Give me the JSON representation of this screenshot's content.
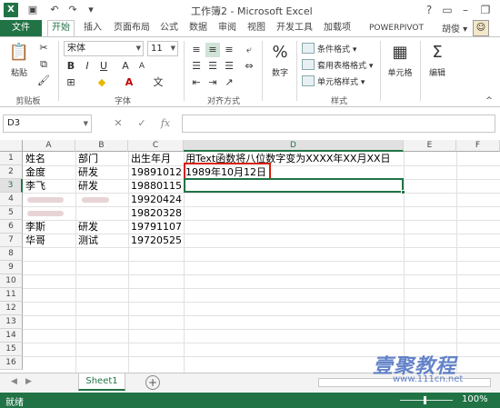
{
  "app": {
    "title": "工作簿2 - Microsoft Excel",
    "badge": "X"
  },
  "ribbon_tabs": {
    "file": "文件",
    "tabs": [
      "开始",
      "插入",
      "页面布局",
      "公式",
      "数据",
      "审阅",
      "视图",
      "开发工具",
      "加载项",
      "POWERPIVOT"
    ],
    "user": "胡俊 ▾"
  },
  "ribbon": {
    "paste": "粘贴",
    "font_name": "宋体",
    "font_size": "11",
    "number_label": "数字",
    "cond_format": "条件格式 ▾",
    "table_format": "套用表格格式 ▾",
    "cell_style": "单元格样式 ▾",
    "cells_label": "单元格",
    "edit_label": "编辑",
    "groups": {
      "clipboard": "剪贴板",
      "font": "字体",
      "align": "对齐方式",
      "styles": "样式"
    }
  },
  "formula_bar": {
    "name_box": "D3",
    "formula": ""
  },
  "sheet": {
    "columns": [
      "A",
      "B",
      "C",
      "D",
      "E",
      "F"
    ],
    "rows": [
      "1",
      "2",
      "3",
      "4",
      "5",
      "6",
      "7",
      "8",
      "9",
      "10",
      "11",
      "12",
      "13",
      "14",
      "15",
      "16"
    ],
    "cells": {
      "A1": "姓名",
      "B1": "部门",
      "C1": "出生年月",
      "D1": "用Text函数将八位数字变为XXXX年XX月XX日",
      "A2": "金度",
      "B2": "研发",
      "C2": "19891012",
      "D2": "1989年10月12日",
      "A3": "李飞",
      "B3": "研发",
      "C3": "19880115",
      "C4": "19920424",
      "C5": "19820328",
      "A6": "李斯",
      "B6": "研发",
      "C6": "19791107",
      "A7": "华哥",
      "B7": "测试",
      "C7": "19720525"
    }
  },
  "sheet_tabs": {
    "active": "Sheet1"
  },
  "status": {
    "text": "就绪",
    "zoom": "100%"
  },
  "watermark": {
    "text": "壹聚教程",
    "url": "www.111cn.net"
  },
  "colors": {
    "excel_green": "#217346",
    "highlight_red": "#d81e06"
  }
}
